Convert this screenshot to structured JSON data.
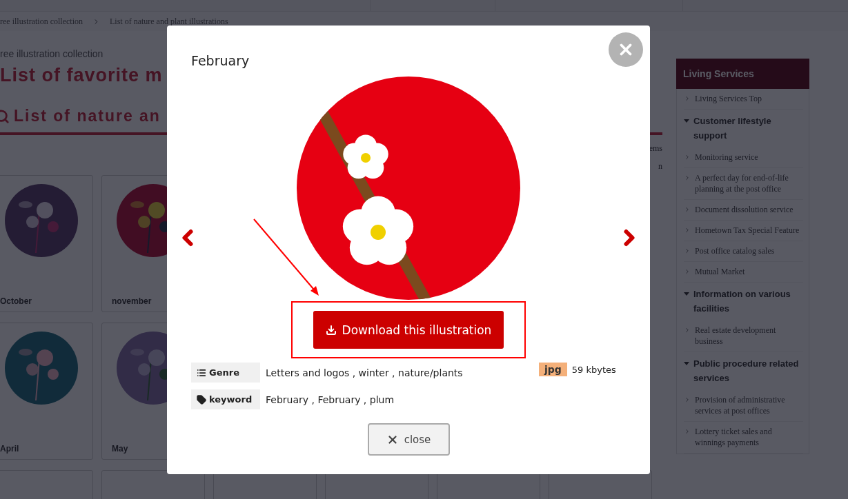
{
  "breadcrumb": [
    "ree illustration collection",
    "List of nature and plant illustrations"
  ],
  "page": {
    "subtitle": "ree illustration collection",
    "title": "List of favorite m",
    "section_heading": "List of nature an",
    "side_fragments": [
      "ems",
      "n"
    ]
  },
  "cards": [
    {
      "label": "October"
    },
    {
      "label": "november"
    },
    {
      "label": "April"
    },
    {
      "label": "May"
    }
  ],
  "sidebar": {
    "title": "Living Services",
    "items": [
      {
        "kind": "link",
        "label": "Living Services Top"
      },
      {
        "kind": "group",
        "label": "Customer lifestyle support"
      },
      {
        "kind": "link",
        "label": "Monitoring service"
      },
      {
        "kind": "link",
        "label": "A perfect day for end-of-life planning at the post office"
      },
      {
        "kind": "link",
        "label": "Document dissolution service"
      },
      {
        "kind": "link",
        "label": "Hometown Tax Special Feature"
      },
      {
        "kind": "link",
        "label": "Post office catalog sales"
      },
      {
        "kind": "link",
        "label": "Mutual Market"
      },
      {
        "kind": "group",
        "label": "Information on various facilities"
      },
      {
        "kind": "link",
        "label": "Real estate development business"
      },
      {
        "kind": "group",
        "label": "Public procedure related services"
      },
      {
        "kind": "link",
        "label": "Provision of administrative services at post offices"
      },
      {
        "kind": "link",
        "label": "Lottery ticket sales and winnings payments"
      }
    ]
  },
  "modal": {
    "title": "February",
    "download_label": "Download this illustration",
    "info": [
      {
        "kind": "genre",
        "label": "Genre",
        "value": "Letters and logos , winter , nature/plants"
      },
      {
        "kind": "keyword",
        "label": "keyword",
        "value": "February , February , plum"
      }
    ],
    "file_type": "jpg",
    "file_size": "59 kbytes",
    "close_label": "close"
  }
}
